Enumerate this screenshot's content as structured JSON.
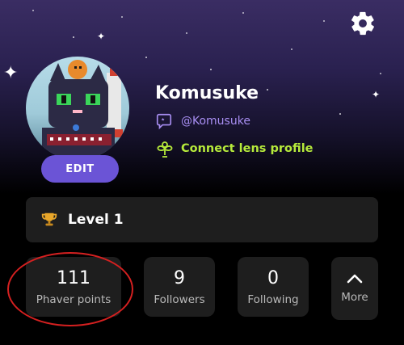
{
  "profile": {
    "name": "Komusuke",
    "handle": "@Komusuke",
    "lens_cta": "Connect lens profile",
    "edit_label": "EDIT"
  },
  "level": {
    "label": "Level 1"
  },
  "stats": [
    {
      "value": "111",
      "label": "Phaver points"
    },
    {
      "value": "9",
      "label": "Followers"
    },
    {
      "value": "0",
      "label": "Following"
    }
  ],
  "more": {
    "label": "More"
  },
  "colors": {
    "accent": "#6b54d6",
    "handle": "#a88ef2",
    "lens": "#b6ea3b",
    "card": "#1e1e1e",
    "highlight": "#d52020"
  },
  "icons": {
    "settings": "gear-icon",
    "handle": "chat-bubble-icon",
    "lens": "lens-sprout-icon",
    "level": "trophy-icon",
    "more": "chevron-up-icon"
  }
}
